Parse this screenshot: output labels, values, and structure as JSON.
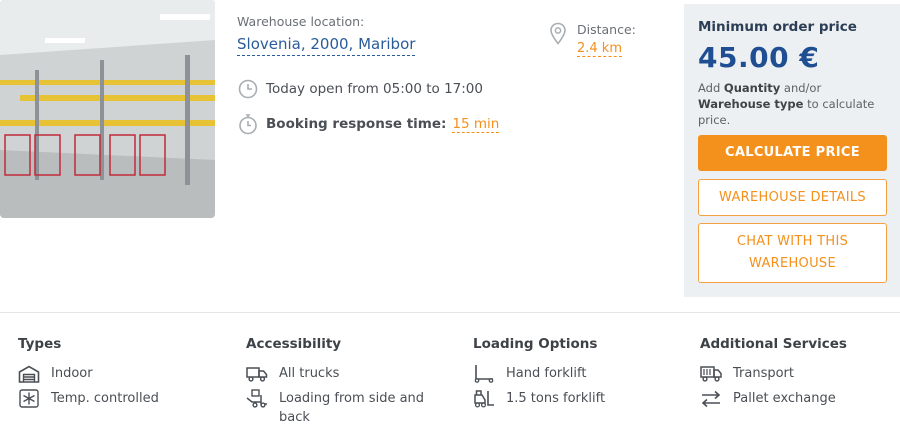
{
  "listing": {
    "location_label": "Warehouse location:",
    "location_value": "Slovenia, 2000, Maribor",
    "hours_text": "Today open from 05:00 to 17:00",
    "response_label": "Booking response time:",
    "response_value": "15 min",
    "distance_label": "Distance:",
    "distance_value": "2.4 km"
  },
  "pricing": {
    "title": "Minimum order price",
    "price": "45.00 €",
    "hint_pre": "Add",
    "hint_quantity": "Quantity",
    "hint_mid": "and/or",
    "hint_warehouse": "Warehouse type",
    "hint_post": "to calculate price.",
    "calculate_label": "CALCULATE PRICE",
    "details_label": "WAREHOUSE DETAILS",
    "chat_label_line1": "CHAT WITH THIS",
    "chat_label_line2": "WAREHOUSE"
  },
  "features": {
    "types": {
      "title": "Types",
      "items": [
        "Indoor",
        "Temp. controlled"
      ]
    },
    "accessibility": {
      "title": "Accessibility",
      "items": [
        "All trucks",
        "Loading from side and back"
      ]
    },
    "loading": {
      "title": "Loading Options",
      "items": [
        "Hand forklift",
        "1.5 tons forklift"
      ]
    },
    "services": {
      "title": "Additional Services",
      "items": [
        "Transport",
        "Pallet exchange"
      ]
    }
  },
  "colors": {
    "accent": "#f4901c",
    "primary_blue": "#1f4f92",
    "panel_bg": "#edf0f2"
  },
  "icons": {
    "photo": "warehouse-photo",
    "hours": "clock-icon",
    "response": "stopwatch-icon",
    "distance": "map-pin-icon",
    "indoor": "warehouse-icon",
    "temp": "snowflake-icon",
    "trucks": "truck-icon",
    "loading_side": "loading-truck-icon",
    "hand_forklift": "hand-forklift-icon",
    "forklift": "forklift-icon",
    "transport": "delivery-truck-icon",
    "pallet_exchange": "exchange-arrows-icon"
  }
}
